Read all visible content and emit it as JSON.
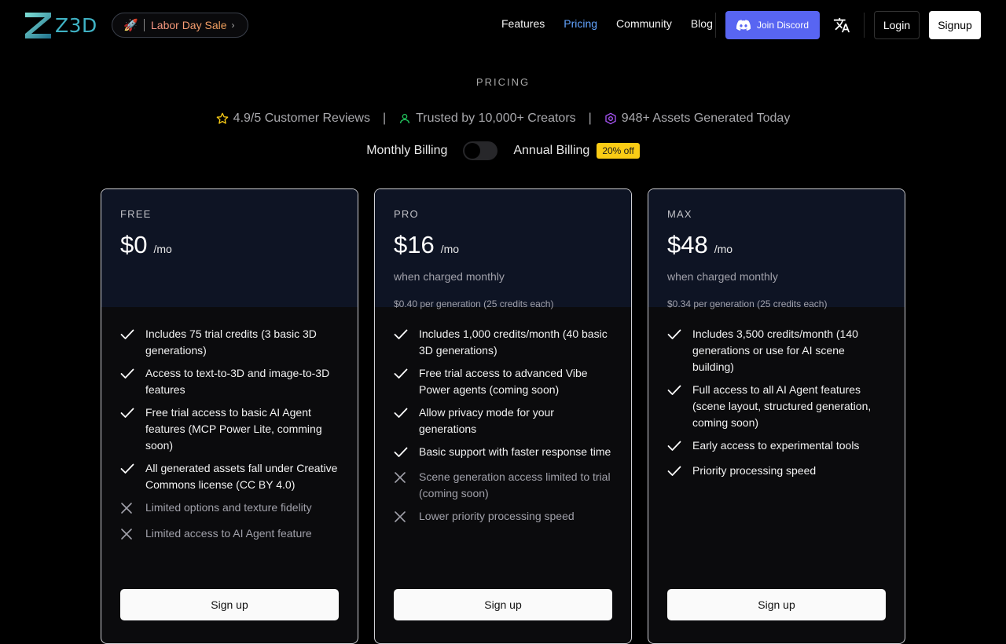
{
  "nav": {
    "brand": "Z3D",
    "promo": {
      "icon": "rocket-icon",
      "emoji": "🚀",
      "label": "Labor Day Sale",
      "chevron": "›"
    },
    "links": [
      {
        "label": "Features",
        "active": false
      },
      {
        "label": "Pricing",
        "active": true
      },
      {
        "label": "Community",
        "active": false
      },
      {
        "label": "Blog",
        "active": false
      }
    ],
    "discord_label": "Join Discord",
    "login_label": "Login",
    "signup_label": "Signup"
  },
  "header": {
    "section_label": "PRICING",
    "stats": [
      {
        "icon": "star-icon",
        "text": "4.9/5 Customer Reviews"
      },
      {
        "icon": "user-icon",
        "text": "Trusted by 10,000+ Creators"
      },
      {
        "icon": "hexagon-icon",
        "text": "948+ Assets Generated Today"
      }
    ],
    "stat_separator": "|"
  },
  "billing": {
    "monthly_label": "Monthly Billing",
    "annual_label": "Annual Billing",
    "discount_badge": "20% off",
    "annual_selected": false
  },
  "plans": [
    {
      "tier": "FREE",
      "price": "$0",
      "period": "/mo",
      "charged_note": "",
      "per_generation": "",
      "features": [
        {
          "text": "Includes 75 trial credits (3 basic 3D generations)",
          "included": true
        },
        {
          "text": "Access to text-to-3D and image-to-3D features",
          "included": true
        },
        {
          "text": "Free trial access to basic AI Agent features (MCP Power Lite, comming soon)",
          "included": true
        },
        {
          "text": "All generated assets fall under Creative Commons license (CC BY 4.0)",
          "included": true
        },
        {
          "text": "Limited options and texture fidelity",
          "included": false
        },
        {
          "text": "Limited access to AI Agent feature",
          "included": false
        }
      ],
      "cta": "Sign up"
    },
    {
      "tier": "PRO",
      "price": "$16",
      "period": "/mo",
      "charged_note": "when charged monthly",
      "per_generation": "$0.40 per generation (25 credits each)",
      "features": [
        {
          "text": "Includes 1,000 credits/month (40 basic 3D generations)",
          "included": true
        },
        {
          "text": "Free trial access to advanced Vibe Power agents (coming soon)",
          "included": true
        },
        {
          "text": "Allow privacy mode for your generations",
          "included": true
        },
        {
          "text": "Basic support with faster response time",
          "included": true
        },
        {
          "text": "Scene generation access limited to trial (coming soon)",
          "included": false
        },
        {
          "text": "Lower priority processing speed",
          "included": false
        }
      ],
      "cta": "Sign up"
    },
    {
      "tier": "MAX",
      "price": "$48",
      "period": "/mo",
      "charged_note": "when charged monthly",
      "per_generation": "$0.34 per generation (25 credits each)",
      "features": [
        {
          "text": "Includes 3,500 credits/month (140 generations or use for AI scene building)",
          "included": true
        },
        {
          "text": "Full access to all AI Agent features (scene layout, structured generation, coming soon)",
          "included": true
        },
        {
          "text": "Early access to experimental tools",
          "included": true
        },
        {
          "text": "Priority processing speed",
          "included": true
        }
      ],
      "cta": "Sign up"
    }
  ],
  "colors": {
    "background": "#000000",
    "accent_link": "#63a4ff",
    "discord": "#5865f2",
    "badge": "#facc15",
    "card_head": "#0e1424",
    "brand": "#3fb2c4"
  }
}
